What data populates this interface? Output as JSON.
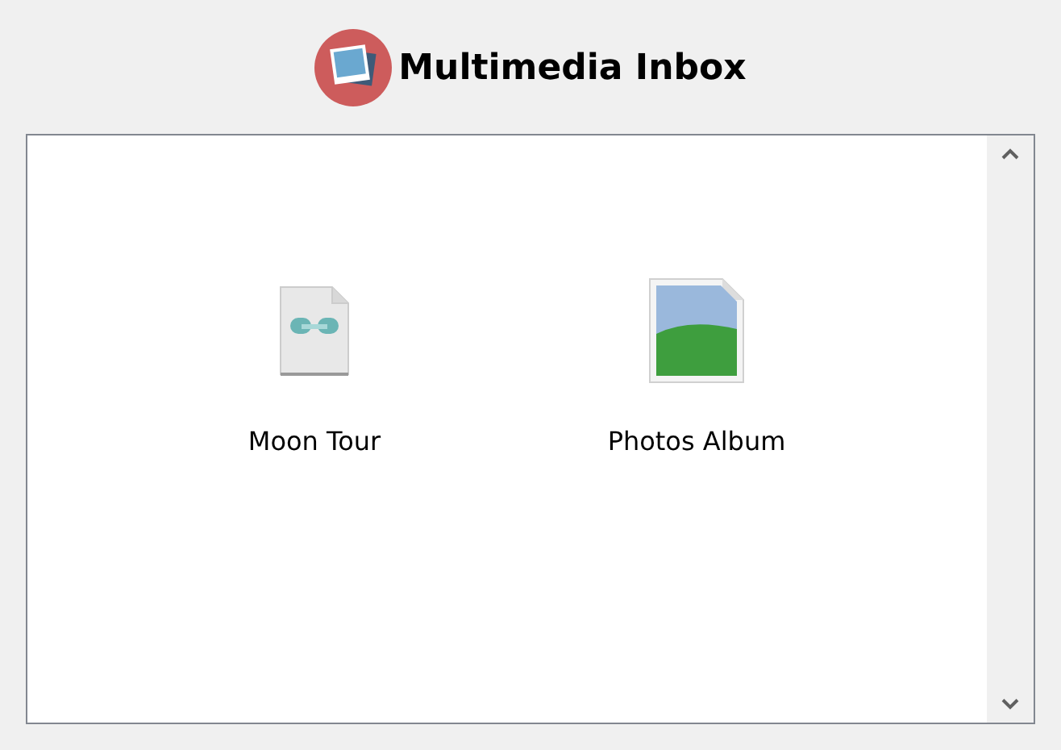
{
  "window": {
    "title": "Multimedia Inbox"
  },
  "items": [
    {
      "label": "Moon Tour",
      "kind": "link-file"
    },
    {
      "label": "Photos Album",
      "kind": "image-file"
    }
  ]
}
